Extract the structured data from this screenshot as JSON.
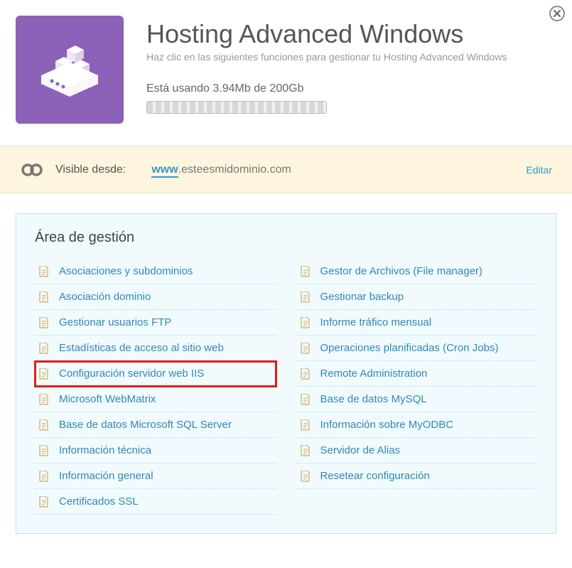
{
  "header": {
    "title": "Hosting Advanced Windows",
    "subtitle": "Haz clic en las siguientes funciones para gestionar tu Hosting Advanced Windows",
    "usage": "Está usando 3.94Mb de 200Gb"
  },
  "domain_bar": {
    "label": "Visible desde:",
    "www": "www",
    "domain": ".esteesmidominio.com",
    "edit": "Editar"
  },
  "mgmt": {
    "heading": "Área de gestión",
    "left": [
      "Asociaciones y subdominios",
      "Asociación dominio",
      "Gestionar usuarios FTP",
      "Estadísticas de acceso al sitio web",
      "Configuración servidor web IIS",
      "Microsoft WebMatrix",
      "Base de datos Microsoft SQL Server",
      "Información técnica",
      "Información general",
      "Certificados SSL"
    ],
    "right": [
      "Gestor de Archivos (File manager)",
      "Gestionar backup",
      "Informe tráfico mensual",
      "Operaciones planificadas (Cron Jobs)",
      "Remote Administration",
      "Base de datos MySQL",
      "Información sobre MyODBC",
      "Servidor de Alias",
      "Resetear configuración"
    ],
    "highlight_left_index": 4
  }
}
